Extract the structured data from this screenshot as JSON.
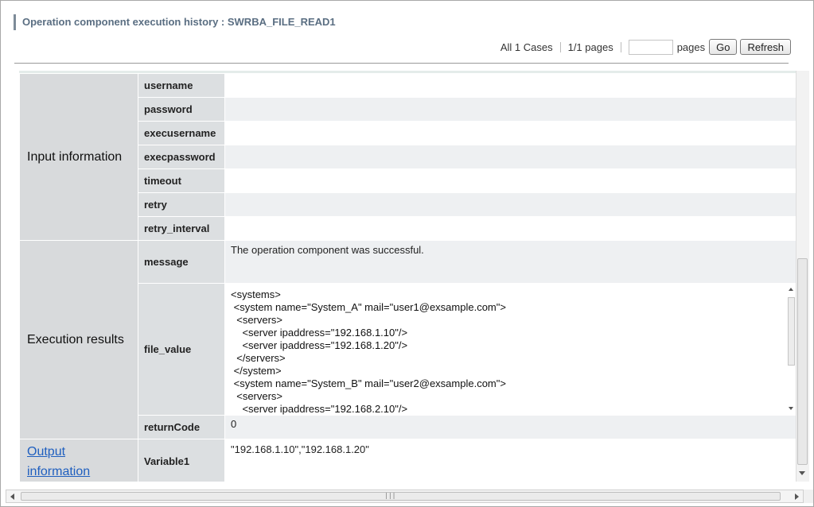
{
  "header": {
    "title": "Operation component execution history : SWRBA_FILE_READ1"
  },
  "pager": {
    "total_cases": "All 1 Cases",
    "page_info": "1/1 pages",
    "page_input_value": "",
    "pages_label": "pages",
    "go_label": "Go",
    "refresh_label": "Refresh"
  },
  "sections": {
    "input": {
      "label": "Input information",
      "params": [
        {
          "name": "username",
          "value": ""
        },
        {
          "name": "password",
          "value": ""
        },
        {
          "name": "execusername",
          "value": ""
        },
        {
          "name": "execpassword",
          "value": ""
        },
        {
          "name": "timeout",
          "value": ""
        },
        {
          "name": "retry",
          "value": ""
        },
        {
          "name": "retry_interval",
          "value": ""
        }
      ]
    },
    "results": {
      "label": "Execution results",
      "message_name": "message",
      "message_value": "The operation component was successful.",
      "file_value_name": "file_value",
      "file_value_text": "<systems>\n <system name=\"System_A\" mail=\"user1@exsample.com\">\n  <servers>\n    <server ipaddress=\"192.168.1.10\"/>\n    <server ipaddress=\"192.168.1.20\"/>\n  </servers>\n </system>\n <system name=\"System_B\" mail=\"user2@exsample.com\">\n  <servers>\n    <server ipaddress=\"192.168.2.10\"/>",
      "return_code_name": "returnCode",
      "return_code_value": "0"
    },
    "output": {
      "label": "Output information",
      "variable_name": "Variable1",
      "variable_value": "\"192.168.1.10\",\"192.168.1.20\""
    }
  },
  "icons": {
    "scroll_down": "triangle-down-icon",
    "scroll_up": "triangle-up-icon",
    "scroll_left": "triangle-left-icon",
    "scroll_right": "triangle-right-icon"
  },
  "colors": {
    "title_text": "#5a6e82",
    "section_bg": "#d8dadc",
    "link": "#1f5fbf"
  }
}
